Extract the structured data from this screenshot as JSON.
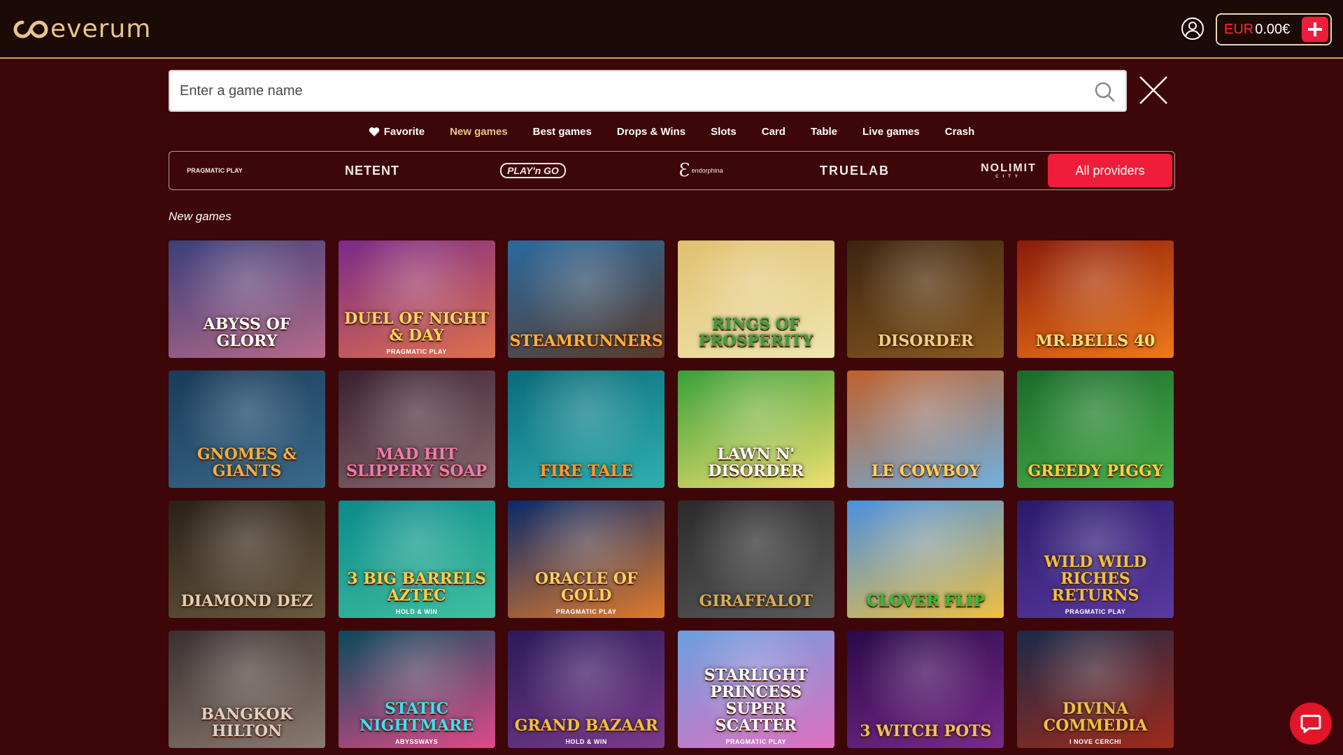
{
  "header": {
    "logo_text": "everum",
    "balance_currency": "EUR",
    "balance_amount": "0.00€"
  },
  "search": {
    "placeholder": "Enter a game name",
    "value": ""
  },
  "categories": [
    {
      "label": "Favorite",
      "icon": "heart-icon"
    },
    {
      "label": "New games",
      "active": true
    },
    {
      "label": "Best games"
    },
    {
      "label": "Drops & Wins"
    },
    {
      "label": "Slots"
    },
    {
      "label": "Card"
    },
    {
      "label": "Table"
    },
    {
      "label": "Live games"
    },
    {
      "label": "Crash"
    }
  ],
  "providers": {
    "pragmatic": "PRAGMATIC PLAY",
    "netent": "NETENT",
    "playngo": "PLAY'n GO",
    "endorphina": "endorphina",
    "truelab": "TRUELAB",
    "nolimit": "NOLIMIT",
    "nolimit_sub": "CITY",
    "all_label": "All providers"
  },
  "section_title": "New games",
  "games": [
    {
      "name": "Abyss of Glory",
      "bg": [
        "#3a3f7a",
        "#b86a8a"
      ],
      "color": "#ffffff"
    },
    {
      "name": "Duel of Night & Day",
      "provider": "PRAGMATIC PLAY",
      "bg": [
        "#7a2a8a",
        "#e0704a"
      ],
      "color": "#ffd45c"
    },
    {
      "name": "Steamrunners",
      "bg": [
        "#2a6aa0",
        "#5a3a2a"
      ],
      "color": "#ffb03a"
    },
    {
      "name": "Rings of Prosperity",
      "bg": [
        "#e0c070",
        "#f0e6b0"
      ],
      "color": "#3aa03a"
    },
    {
      "name": "Disorder",
      "bg": [
        "#3a2410",
        "#8a5a20"
      ],
      "color": "#f0d080"
    },
    {
      "name": "Mr.Bells 40",
      "bg": [
        "#8a1a0a",
        "#f07a1a"
      ],
      "color": "#ffe070"
    },
    {
      "name": "Gnomes & Giants",
      "bg": [
        "#1a3a5a",
        "#3a6a8a"
      ],
      "color": "#f0b040"
    },
    {
      "name": "Mad Hit Slippery Soap",
      "bg": [
        "#3a2030",
        "#8a6a70"
      ],
      "color": "#f07ab0"
    },
    {
      "name": "Fire Tale",
      "bg": [
        "#0a6a7a",
        "#30b0b0"
      ],
      "color": "#ff9a2a"
    },
    {
      "name": "Lawn n' Disorder",
      "bg": [
        "#3aa03a",
        "#f0e070"
      ],
      "color": "#ffffff"
    },
    {
      "name": "Le Cowboy",
      "bg": [
        "#c0602a",
        "#70b0e0"
      ],
      "color": "#ffd060"
    },
    {
      "name": "Greedy Piggy",
      "bg": [
        "#1a6a2a",
        "#4ab04a"
      ],
      "color": "#ffd040"
    },
    {
      "name": "Diamond Dez",
      "bg": [
        "#2a2018",
        "#6a5a40"
      ],
      "color": "#e0d0b0"
    },
    {
      "name": "3 Big Barrels Aztec",
      "provider": "HOLD & WIN",
      "bg": [
        "#0a8a8a",
        "#40c0a0"
      ],
      "color": "#ffd040"
    },
    {
      "name": "Oracle of Gold",
      "provider": "PRAGMATIC PLAY",
      "bg": [
        "#0a2a6a",
        "#e07a2a"
      ],
      "color": "#ffd060"
    },
    {
      "name": "Giraffalot",
      "bg": [
        "#2a2a2a",
        "#5a5a5a"
      ],
      "color": "#d0b060"
    },
    {
      "name": "Clover Flip",
      "bg": [
        "#4a90e0",
        "#f0c040"
      ],
      "color": "#30c030"
    },
    {
      "name": "Wild Wild Riches Returns",
      "provider": "PRAGMATIC PLAY",
      "bg": [
        "#2a1a6a",
        "#5a3aa0"
      ],
      "color": "#f0c040"
    },
    {
      "name": "Bangkok Hilton",
      "bg": [
        "#3a3030",
        "#8a7a70"
      ],
      "color": "#e0d0c0"
    },
    {
      "name": "Static Nightmare",
      "provider": "ABYSSWAYS",
      "bg": [
        "#0a4a5a",
        "#e04a8a"
      ],
      "color": "#40e0f0"
    },
    {
      "name": "Grand Bazaar",
      "provider": "HOLD & WIN",
      "bg": [
        "#2a1a5a",
        "#7a3a8a"
      ],
      "color": "#f0c040"
    },
    {
      "name": "Starlight Princess Super Scatter",
      "provider": "PRAGMATIC PLAY",
      "bg": [
        "#6aa0e0",
        "#e070c0"
      ],
      "color": "#ffffff"
    },
    {
      "name": "3 Witch Pots",
      "bg": [
        "#2a0a4a",
        "#7a2a8a"
      ],
      "color": "#f0c060"
    },
    {
      "name": "Divina Commedia",
      "provider": "I NOVE CERCHI",
      "bg": [
        "#1a2a4a",
        "#a02a1a"
      ],
      "color": "#f0c040"
    }
  ]
}
